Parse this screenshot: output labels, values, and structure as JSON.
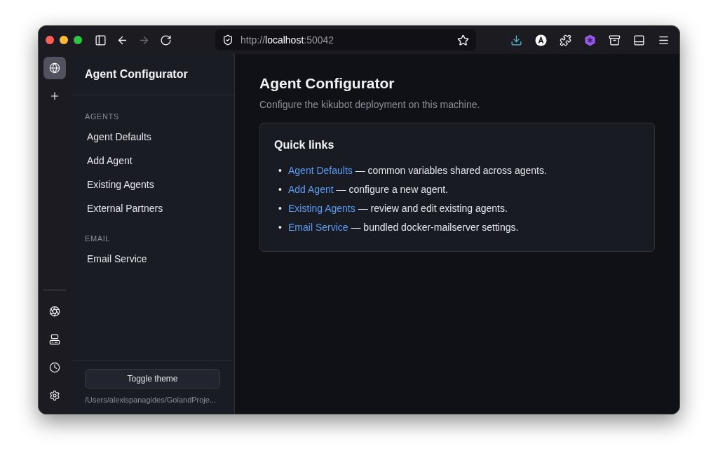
{
  "browser": {
    "url": {
      "scheme": "http://",
      "host": "localhost",
      "port": ":50042"
    }
  },
  "rail": {
    "top": [
      {
        "kind": "globe",
        "selected": true
      },
      {
        "kind": "plus",
        "selected": false
      }
    ],
    "bottom": [
      {
        "kind": "aperture"
      },
      {
        "kind": "computer"
      },
      {
        "kind": "clock"
      },
      {
        "kind": "settings"
      }
    ]
  },
  "sidebar": {
    "title": "Agent Configurator",
    "sections": [
      {
        "heading": "AGENTS",
        "items": [
          "Agent Defaults",
          "Add Agent",
          "Existing Agents",
          "External Partners"
        ]
      },
      {
        "heading": "EMAIL",
        "items": [
          "Email Service"
        ]
      }
    ],
    "toggle_button": "Toggle theme",
    "path": "/Users/alexispanagides/GolandProje..."
  },
  "main": {
    "title": "Agent Configurator",
    "subtitle": "Configure the kikubot deployment on this machine.",
    "card": {
      "title": "Quick links",
      "links": [
        {
          "marker": "•",
          "link": "Agent Defaults",
          "text": "— common variables shared across agents."
        },
        {
          "marker": "•",
          "link": "Add Agent",
          "text": "— configure a new agent."
        },
        {
          "marker": "•",
          "link": "Existing Agents",
          "text": "— review and edit existing agents."
        },
        {
          "marker": "•",
          "link": "Email Service",
          "text": "— bundled docker-mailserver settings."
        }
      ]
    }
  }
}
